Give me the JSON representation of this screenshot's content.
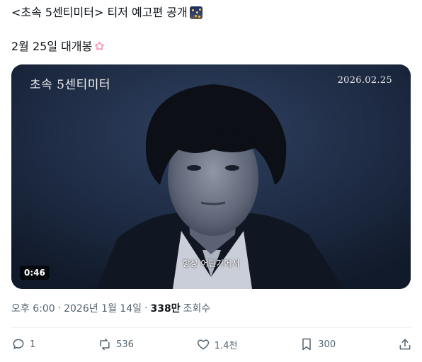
{
  "post": {
    "title_line": "<초속 5센티미터> 티저 예고편 공개",
    "release_line": "2월 25일 대개봉"
  },
  "video": {
    "overlay_title": "초속 5센티미터",
    "overlay_date": "2026.02.25",
    "subtitle": "항상 어딘가에서",
    "duration": "0:46"
  },
  "meta": {
    "time": "오후 6:00",
    "separator": "·",
    "date": "2026년 1월 14일",
    "views_count": "338만",
    "views_label": "조회수"
  },
  "actions": {
    "replies": "1",
    "reposts": "536",
    "likes": "1.4천",
    "bookmarks": "300"
  },
  "icons": [
    "night-city-emoji",
    "cherry-blossom-emoji",
    "reply-icon",
    "repost-icon",
    "like-icon",
    "bookmark-icon",
    "share-icon"
  ]
}
